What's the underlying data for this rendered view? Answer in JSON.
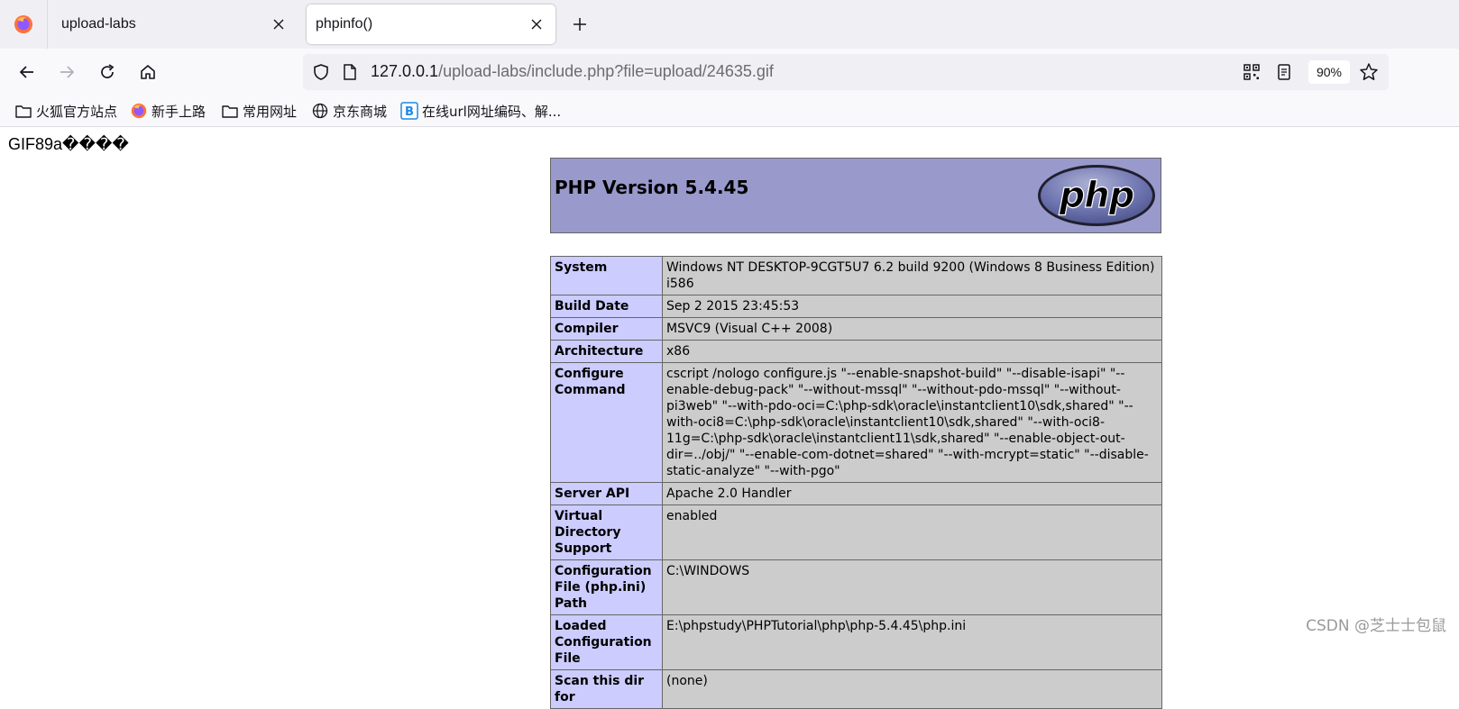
{
  "browser": {
    "tabs": [
      {
        "title": "upload-labs",
        "active": false
      },
      {
        "title": "phpinfo()",
        "active": true
      }
    ],
    "url": {
      "host": "127.0.0.1",
      "path": "/upload-labs/include.php?file=upload/24635.gif"
    },
    "zoom": "90%",
    "bookmarks": [
      {
        "label": "火狐官方站点",
        "icon": "folder-icon"
      },
      {
        "label": "新手上路",
        "icon": "firefox-icon"
      },
      {
        "label": "常用网址",
        "icon": "folder-icon"
      },
      {
        "label": "京东商城",
        "icon": "globe-icon"
      },
      {
        "label": "在线url网址编码、解...",
        "icon": "b-logo-icon"
      }
    ]
  },
  "page": {
    "gif_header_text": "GIF89a����",
    "php_version": "PHP Version 5.4.45",
    "php_logo_text": "php",
    "info_rows": [
      {
        "key": "System",
        "value": "Windows NT DESKTOP-9CGT5U7 6.2 build 9200 (Windows 8 Business Edition) i586"
      },
      {
        "key": "Build Date",
        "value": "Sep 2 2015 23:45:53"
      },
      {
        "key": "Compiler",
        "value": "MSVC9 (Visual C++ 2008)"
      },
      {
        "key": "Architecture",
        "value": "x86"
      },
      {
        "key": "Configure Command",
        "value": "cscript /nologo configure.js \"--enable-snapshot-build\" \"--disable-isapi\" \"--enable-debug-pack\" \"--without-mssql\" \"--without-pdo-mssql\" \"--without-pi3web\" \"--with-pdo-oci=C:\\php-sdk\\oracle\\instantclient10\\sdk,shared\" \"--with-oci8=C:\\php-sdk\\oracle\\instantclient10\\sdk,shared\" \"--with-oci8-11g=C:\\php-sdk\\oracle\\instantclient11\\sdk,shared\" \"--enable-object-out-dir=../obj/\" \"--enable-com-dotnet=shared\" \"--with-mcrypt=static\" \"--disable-static-analyze\" \"--with-pgo\""
      },
      {
        "key": "Server API",
        "value": "Apache 2.0 Handler"
      },
      {
        "key": "Virtual Directory Support",
        "value": "enabled"
      },
      {
        "key": "Configuration File (php.ini) Path",
        "value": "C:\\WINDOWS"
      },
      {
        "key": "Loaded Configuration File",
        "value": "E:\\phpstudy\\PHPTutorial\\php\\php-5.4.45\\php.ini"
      },
      {
        "key": "Scan this dir for",
        "value": "(none)"
      }
    ]
  },
  "watermark": "CSDN @芝士士包鼠",
  "colors": {
    "php_header_bg": "#9999cc",
    "key_cell_bg": "#ccccff",
    "value_cell_bg": "#cccccc",
    "tabstrip_bg": "#f0f0f4"
  }
}
